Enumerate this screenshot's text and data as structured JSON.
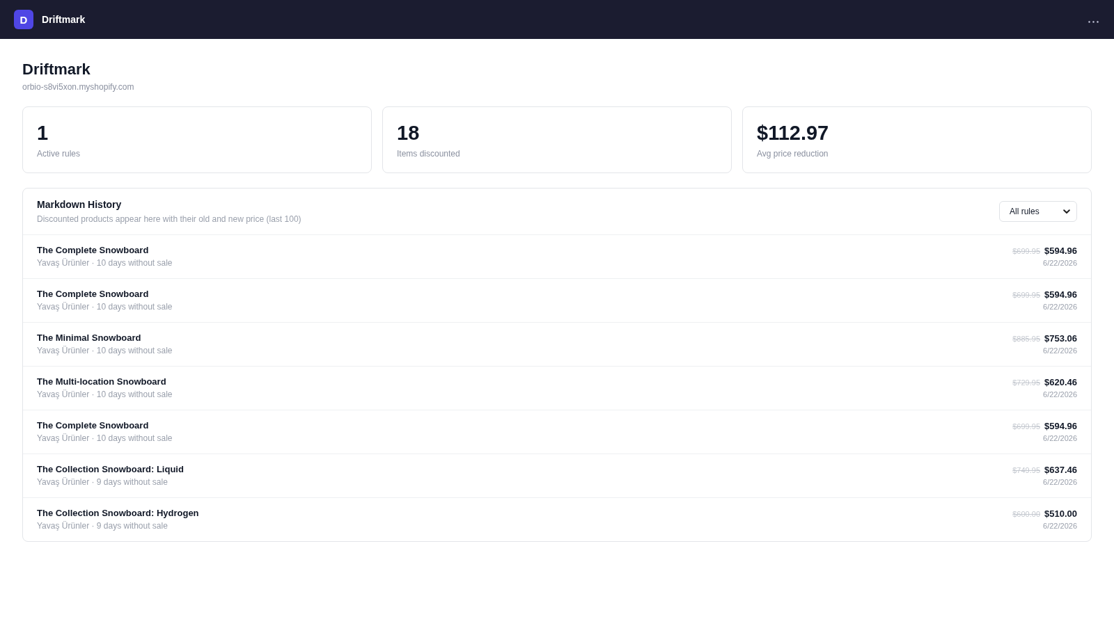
{
  "topbar": {
    "logo_letter": "D",
    "app_name": "Driftmark"
  },
  "header": {
    "title": "Driftmark",
    "subtitle": "orbio-s8vi5xon.myshopify.com"
  },
  "stats": [
    {
      "value": "1",
      "label": "Active rules"
    },
    {
      "value": "18",
      "label": "Items discounted"
    },
    {
      "value": "$112.97",
      "label": "Avg price reduction"
    }
  ],
  "history": {
    "title": "Markdown History",
    "subtitle": "Discounted products appear here with their old and new price (last 100)",
    "filter": {
      "value": "All rules"
    },
    "rows": [
      {
        "product": "The Complete Snowboard",
        "meta": "Yavaş Ürünler · 10 days without sale",
        "old_price": "$699.95",
        "new_price": "$594.96",
        "date": "6/22/2026"
      },
      {
        "product": "The Complete Snowboard",
        "meta": "Yavaş Ürünler · 10 days without sale",
        "old_price": "$699.95",
        "new_price": "$594.96",
        "date": "6/22/2026"
      },
      {
        "product": "The Minimal Snowboard",
        "meta": "Yavaş Ürünler · 10 days without sale",
        "old_price": "$885.95",
        "new_price": "$753.06",
        "date": "6/22/2026"
      },
      {
        "product": "The Multi-location Snowboard",
        "meta": "Yavaş Ürünler · 10 days without sale",
        "old_price": "$729.95",
        "new_price": "$620.46",
        "date": "6/22/2026"
      },
      {
        "product": "The Complete Snowboard",
        "meta": "Yavaş Ürünler · 10 days without sale",
        "old_price": "$699.95",
        "new_price": "$594.96",
        "date": "6/22/2026"
      },
      {
        "product": "The Collection Snowboard: Liquid",
        "meta": "Yavaş Ürünler · 9 days without sale",
        "old_price": "$749.95",
        "new_price": "$637.46",
        "date": "6/22/2026"
      },
      {
        "product": "The Collection Snowboard: Hydrogen",
        "meta": "Yavaş Ürünler · 9 days without sale",
        "old_price": "$600.00",
        "new_price": "$510.00",
        "date": "6/22/2026"
      }
    ]
  }
}
